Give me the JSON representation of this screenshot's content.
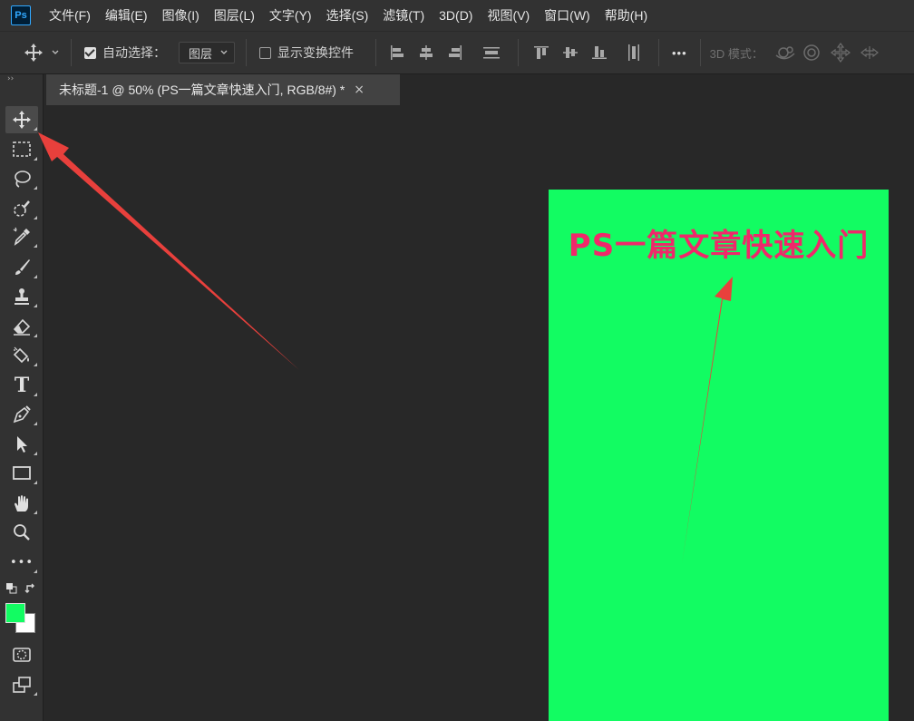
{
  "app": {
    "logo": "Ps"
  },
  "menu": [
    "文件(F)",
    "编辑(E)",
    "图像(I)",
    "图层(L)",
    "文字(Y)",
    "选择(S)",
    "滤镜(T)",
    "3D(D)",
    "视图(V)",
    "窗口(W)",
    "帮助(H)"
  ],
  "options": {
    "auto_select_label": "自动选择：",
    "auto_select_checked": true,
    "target_select_value": "图层",
    "show_transform_label": "显示变换控件",
    "show_transform_checked": false,
    "more_label": "•••",
    "mode_3d_label": "3D 模式："
  },
  "document_tab": {
    "title": "未标题-1 @ 50% (PS一篇文章快速入门, RGB/8#) *",
    "close_symbol": "×"
  },
  "document": {
    "background_color": "#12fc62",
    "text": "PS一篇文章快速入门",
    "text_color": "#f0286a"
  },
  "tools": {
    "type_tool_glyph": "T",
    "more_glyph": "•••",
    "foreground_color": "#12fc62",
    "background_color": "#ffffff"
  },
  "annotations": {
    "arrow_color": "#e8403c"
  }
}
